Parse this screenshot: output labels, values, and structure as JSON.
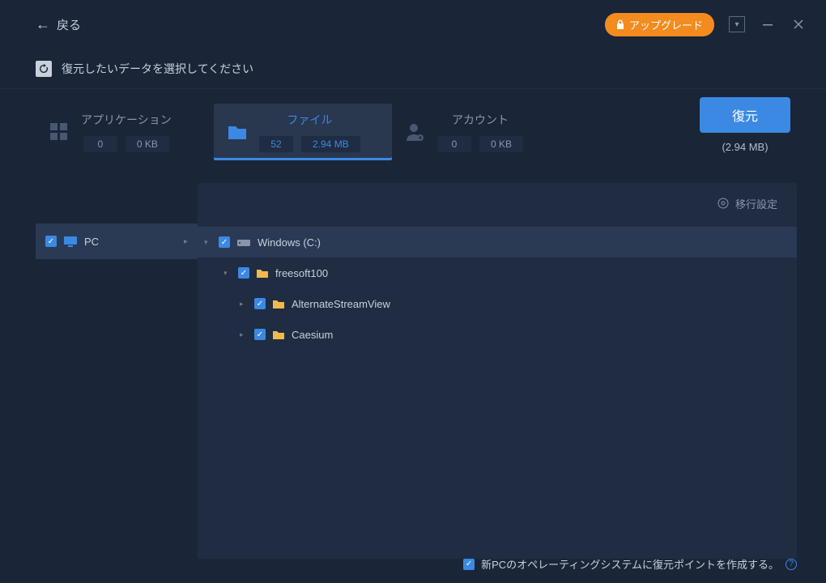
{
  "header": {
    "back_label": "戻る",
    "upgrade_label": "アップグレード"
  },
  "instruction": "復元したいデータを選択してください",
  "action": {
    "restore_label": "復元",
    "total_size": "(2.94 MB)"
  },
  "categories": [
    {
      "key": "apps",
      "title": "アプリケーション",
      "count": "0",
      "size": "0 KB",
      "active": false
    },
    {
      "key": "files",
      "title": "ファイル",
      "count": "52",
      "size": "2.94 MB",
      "active": true
    },
    {
      "key": "accounts",
      "title": "アカウント",
      "count": "0",
      "size": "0 KB",
      "active": false
    }
  ],
  "settings_label": "移行設定",
  "sidebar": {
    "pc_label": "PC"
  },
  "tree": [
    {
      "level": 0,
      "label": "Windows (C:)",
      "checked": true,
      "expanded": true,
      "icon": "drive"
    },
    {
      "level": 1,
      "label": "freesoft100",
      "checked": true,
      "expanded": true,
      "icon": "folder"
    },
    {
      "level": 2,
      "label": "AlternateStreamView",
      "checked": true,
      "expanded": false,
      "icon": "folder"
    },
    {
      "level": 2,
      "label": "Caesium",
      "checked": true,
      "expanded": false,
      "icon": "folder"
    }
  ],
  "footer": {
    "restore_point_label": "新PCのオペレーティングシステムに復元ポイントを作成する。"
  }
}
